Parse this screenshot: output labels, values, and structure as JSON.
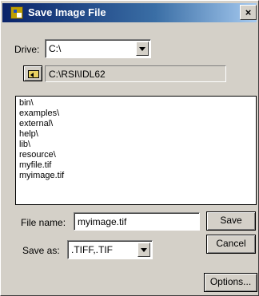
{
  "window": {
    "title": "Save Image File",
    "close_label": "×"
  },
  "drive": {
    "label": "Drive:",
    "value": "C:\\"
  },
  "path": {
    "value": "C:\\RSI\\IDL62"
  },
  "files": [
    "bin\\",
    "examples\\",
    "external\\",
    "help\\",
    "lib\\",
    "resource\\",
    "myfile.tif",
    "myimage.tif"
  ],
  "filename": {
    "label": "File name:",
    "value": "myimage.tif"
  },
  "save_as": {
    "label": "Save as:",
    "value": ".TIFF,.TIF"
  },
  "buttons": {
    "save": "Save",
    "cancel": "Cancel",
    "options": "Options..."
  }
}
